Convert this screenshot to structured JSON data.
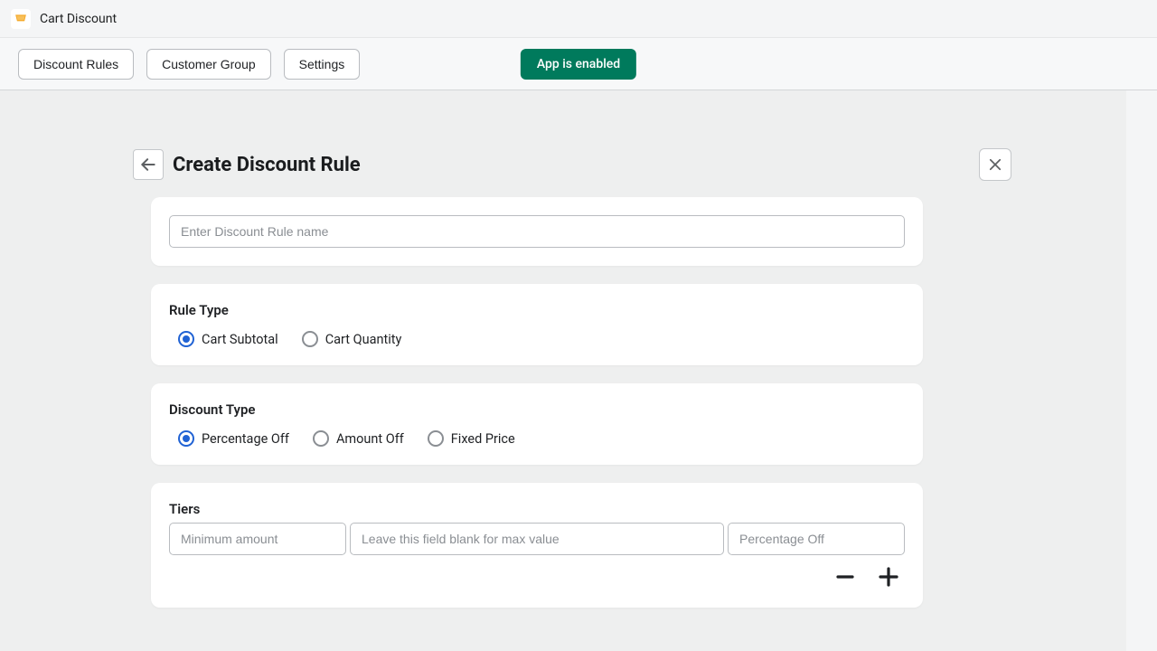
{
  "app": {
    "title": "Cart Discount"
  },
  "nav": {
    "discount_rules": "Discount Rules",
    "customer_group": "Customer Group",
    "settings": "Settings"
  },
  "status": {
    "label": "App is enabled"
  },
  "page": {
    "title": "Create Discount Rule"
  },
  "form": {
    "name_placeholder": "Enter Discount Rule name",
    "name_value": ""
  },
  "rule_type": {
    "label": "Rule Type",
    "options": {
      "subtotal": "Cart Subtotal",
      "quantity": "Cart Quantity"
    },
    "selected": "subtotal"
  },
  "discount_type": {
    "label": "Discount Type",
    "options": {
      "percentage": "Percentage Off",
      "amount": "Amount Off",
      "fixed": "Fixed Price"
    },
    "selected": "percentage"
  },
  "tiers": {
    "label": "Tiers",
    "min_placeholder": "Minimum amount",
    "max_placeholder": "Leave this field blank for max value",
    "value_placeholder": "Percentage Off",
    "rows": [
      {
        "min": "",
        "max": "",
        "value": ""
      }
    ]
  }
}
